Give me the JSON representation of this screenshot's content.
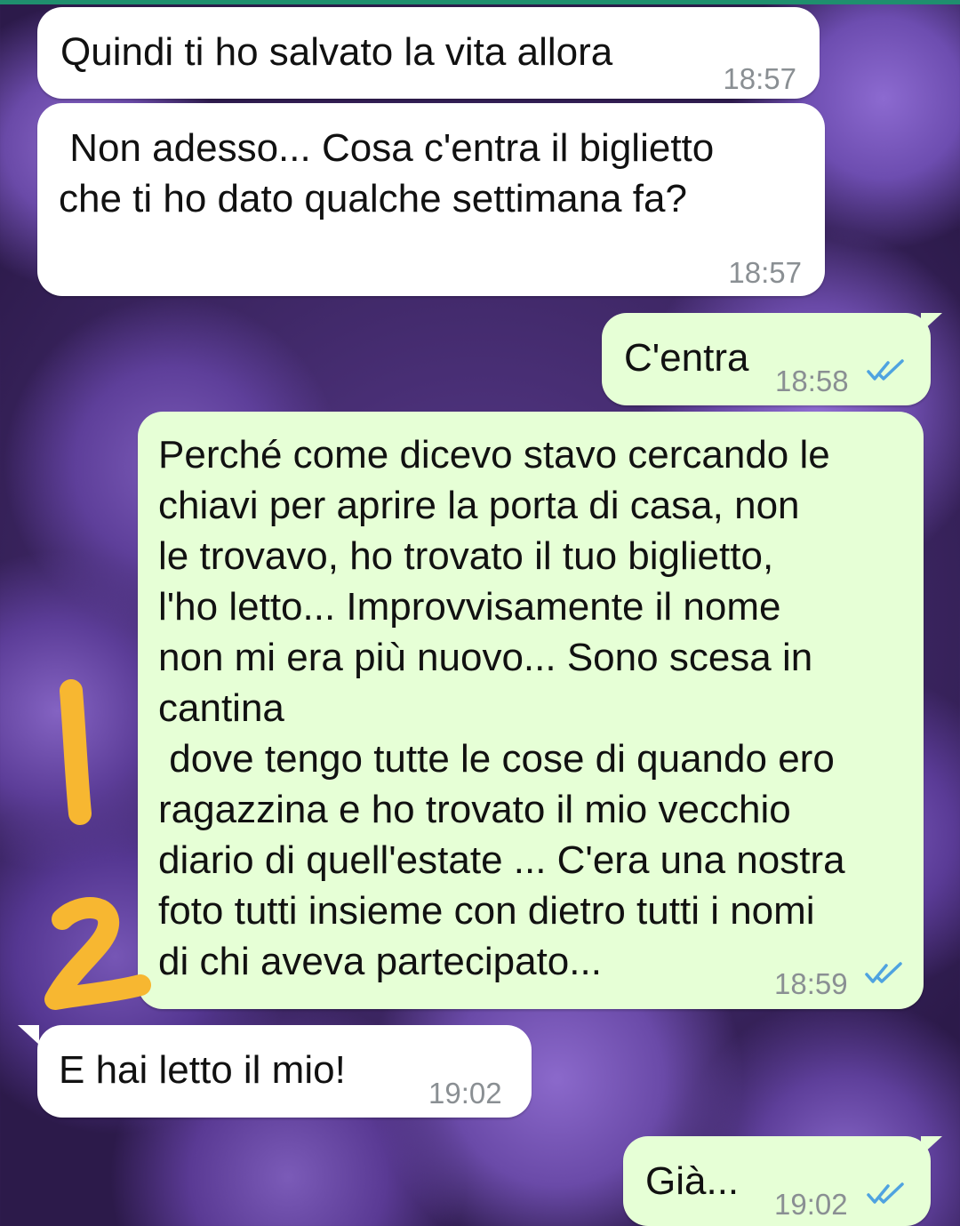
{
  "theme": {
    "incoming_color": "#ffffff",
    "outgoing_color": "#e6ffd6",
    "time_color": "#8a8f93",
    "read_tick_color": "#4fa3e0",
    "annotation_color": "#f7b731"
  },
  "messages": [
    {
      "direction": "in",
      "text": "Quindi ti ho salvato la vita allora",
      "time": "18:57"
    },
    {
      "direction": "in",
      "text": " Non adesso... Cosa c'entra il biglietto\nche ti ho dato qualche settimana fa?",
      "time": "18:57"
    },
    {
      "direction": "out",
      "text": "C'entra",
      "time": "18:58",
      "status": "read"
    },
    {
      "direction": "out",
      "text": "Perché come dicevo stavo cercando le\nchiavi per aprire la porta di casa, non\nle trovavo, ho trovato il tuo biglietto,\nl'ho letto... Improvvisamente il nome\nnon mi era più nuovo... Sono scesa in\ncantina\n dove tengo tutte le cose di quando ero\nragazzina e ho trovato il mio vecchio\ndiario di quell'estate ... C'era una nostra\nfoto tutti insieme con dietro tutti i nomi\ndi chi aveva partecipato...",
      "time": "18:59",
      "status": "read"
    },
    {
      "direction": "in",
      "text": "E hai letto il mio!",
      "time": "19:02"
    },
    {
      "direction": "out",
      "text": "Già...",
      "time": "19:02",
      "status": "read"
    }
  ],
  "icons": {
    "read_receipt": "double-check-icon"
  }
}
